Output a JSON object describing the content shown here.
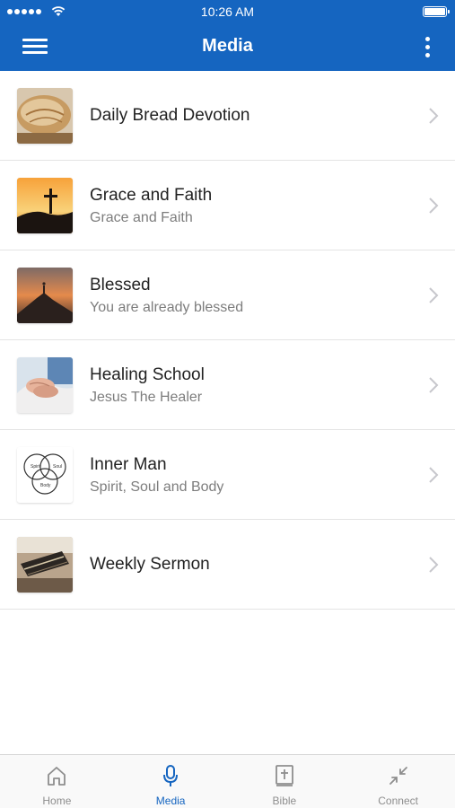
{
  "status_bar": {
    "time": "10:26 AM"
  },
  "header": {
    "title": "Media"
  },
  "items": [
    {
      "title": "Daily Bread Devotion",
      "subtitle": "",
      "thumb": "bread"
    },
    {
      "title": "Grace and Faith",
      "subtitle": "Grace and Faith",
      "thumb": "cross-sunset"
    },
    {
      "title": "Blessed",
      "subtitle": "You are already blessed",
      "thumb": "mountain-sunrise"
    },
    {
      "title": "Healing School",
      "subtitle": "Jesus The Healer",
      "thumb": "holding-hands"
    },
    {
      "title": "Inner Man",
      "subtitle": "Spirit, Soul and Body",
      "thumb": "venn-diagram",
      "venn": {
        "spirit": "Spirit",
        "soul": "Soul",
        "body": "Body"
      }
    },
    {
      "title": "Weekly Sermon",
      "subtitle": "",
      "thumb": "bible"
    }
  ],
  "tabs": [
    {
      "label": "Home",
      "icon": "home-icon",
      "active": false
    },
    {
      "label": "Media",
      "icon": "microphone-icon",
      "active": true
    },
    {
      "label": "Bible",
      "icon": "bible-icon",
      "active": false
    },
    {
      "label": "Connect",
      "icon": "connect-icon",
      "active": false
    }
  ],
  "colors": {
    "primary": "#1565c0",
    "tab_inactive": "#8e8e8e",
    "divider": "#e4e4e4"
  }
}
